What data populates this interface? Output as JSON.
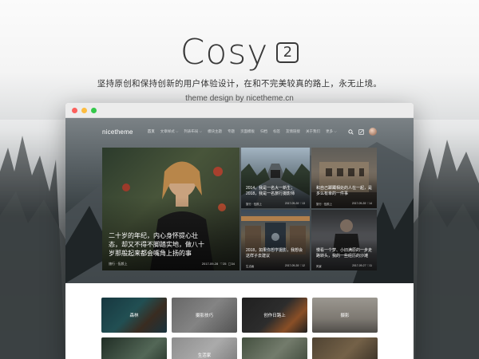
{
  "brand": {
    "logo_word": "Cosy",
    "version": "2",
    "slogan": "坚持原创和保持创新的用户体验设计，在和不完美较真的路上，永无止境。",
    "credit": "theme design by nicetheme.cn"
  },
  "colors": {
    "close_dot": "#fc605c",
    "minimize_dot": "#fdbc40",
    "maximize_dot": "#34c84a"
  },
  "site": {
    "logo": "nicetheme",
    "nav_items": [
      "首页",
      "文章样式 ⌵",
      "列表布局 ⌵",
      "模块主题",
      "专题",
      "页面模板",
      "归档",
      "标签",
      "友情链接",
      "关于我们",
      "更多 ⌵"
    ],
    "tool_icons": [
      "search-icon",
      "edit-icon",
      "avatar"
    ]
  },
  "featured": {
    "main": {
      "title": "二十岁的年纪，内心身怀提心壮态，却又不得不脚踏实地，做八十岁那般起来都会嘴角上扬的事",
      "author": "旅行 · 伍颜上",
      "date": "2017-09-28",
      "likes": "25",
      "comments": "34"
    },
    "side": [
      {
        "title": "2014，我是一名大一新生；2018，我是一名旅行摄影师",
        "author": "旅行 · 伍颜上",
        "date": "2017-09-28",
        "likes": "13"
      },
      {
        "title": "和自己踯躅相处的人在一起，是多么有幸的一件事",
        "author": "旅行 · 伍颜上",
        "date": "2017-09-28",
        "likes": "14"
      },
      {
        "title": "2018，如果你想学摄影，我想会这样子去建议",
        "author": "生活画",
        "date": "2017-09-28",
        "likes": "12"
      },
      {
        "title": "慢看一个梦、小旧满原的一步走路转头，我的一些经历的沙滩",
        "author": "风景",
        "date": "2017-09-27",
        "likes": "11"
      }
    ]
  },
  "categories": [
    {
      "label": "森林"
    },
    {
      "label": "摄影技巧"
    },
    {
      "label": "创作日路上"
    },
    {
      "label": "摄影"
    },
    {
      "label": ""
    },
    {
      "label": "生活家"
    },
    {
      "label": ""
    },
    {
      "label": ""
    }
  ]
}
